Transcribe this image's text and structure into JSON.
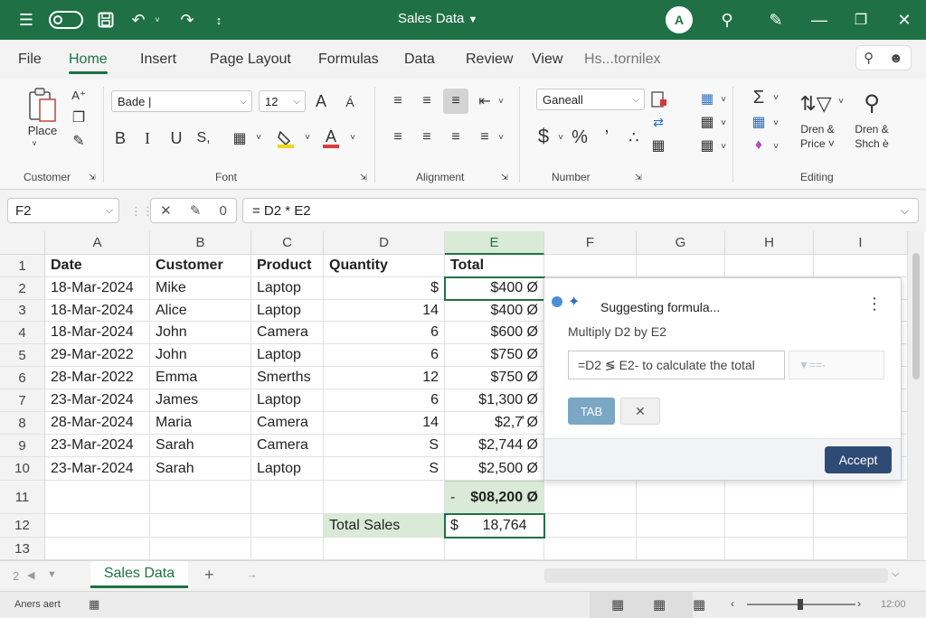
{
  "titlebar": {
    "title": "Sales Data",
    "autosave_state": "O",
    "avatar_initial": "А"
  },
  "menu_tabs": [
    {
      "label": "File"
    },
    {
      "label": "Home"
    },
    {
      "label": "Insert"
    },
    {
      "label": "Page Layout"
    },
    {
      "label": "Formulas"
    },
    {
      "label": "Data"
    },
    {
      "label": "Review"
    },
    {
      "label": "View"
    },
    {
      "label": "Hs...tornilex"
    }
  ],
  "ribbon": {
    "clipboard": {
      "paste_label": "Place",
      "group_label": "Customer"
    },
    "font": {
      "font_name": "Bade |",
      "font_size": "12",
      "group_label": "Font"
    },
    "alignment": {
      "group_label": "Alignment"
    },
    "number": {
      "format": "Ganeall",
      "group_label": "Number"
    },
    "editing": {
      "sort_label_1": "Dren &",
      "sort_label_2": "Price ˅",
      "find_label_1": "Dren &",
      "find_label_2": "Shch è",
      "group_label": "Editing"
    }
  },
  "formula_bar": {
    "name_box": "F2",
    "formula": "= D2 * E2"
  },
  "grid": {
    "columns": [
      "A",
      "B",
      "C",
      "D",
      "E",
      "F",
      "G",
      "H",
      "I"
    ],
    "rows": [
      [
        "1",
        "Date",
        "Customer",
        "Product",
        "Quantity",
        "Total"
      ],
      [
        "2",
        "18-Mar-2024",
        "Mike",
        "Laptop",
        "$",
        "$400 Ø"
      ],
      [
        "3",
        "18-Mar-2024",
        "Alice",
        "Laptop",
        "14",
        "$400 Ø"
      ],
      [
        "4",
        "18-Mar-2024",
        "John",
        "Camera",
        "6",
        "$600 Ø"
      ],
      [
        "5",
        "29-Mar-2022",
        "John",
        "Laptop",
        "6",
        "$750 Ø"
      ],
      [
        "6",
        "28-Mar-2022",
        "Emma",
        "Smerths",
        "12",
        "$750 Ø"
      ],
      [
        "7",
        "23-Mar-2024",
        "James",
        "Laptop",
        "6",
        "$1,300 Ø"
      ],
      [
        "8",
        "28-Mar-2024",
        "Maria",
        "Camera",
        "14",
        "$2,7̕ Ø"
      ],
      [
        "9",
        "23-Mar-2024",
        "Sarah",
        "Camera",
        "S",
        "$2,744 Ø"
      ],
      [
        "10",
        "23-Mar-2024",
        "Sarah",
        "Laptop",
        "S",
        "$2,500 Ø"
      ],
      [
        "11",
        "",
        "",
        "",
        "",
        "$08,200 Ø"
      ],
      [
        "12",
        "",
        "",
        "",
        "Total Sales",
        "$      18,764"
      ],
      [
        "13",
        "",
        "",
        "",
        "",
        ""
      ]
    ],
    "row11_prefix": "-"
  },
  "suggestion": {
    "title": "Suggesting formula...",
    "description": "Multiply D2 by E2",
    "input_text": "=D2 ≶ E2- to calculate the total",
    "input2_text": "▼==-",
    "tab_label": "TAB",
    "dismiss_label": "✕",
    "accept_label": "Accept"
  },
  "sheets": {
    "nav_count": "2",
    "active_sheet": "Sales Data"
  },
  "status": {
    "left_text": "Aners aert",
    "right_text": "12:00"
  }
}
